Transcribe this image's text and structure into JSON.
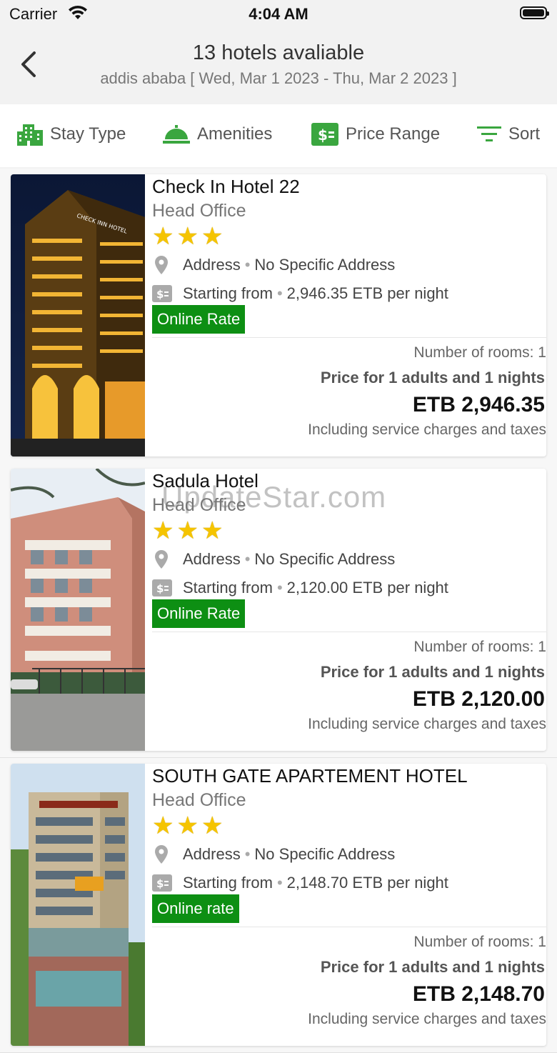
{
  "status_bar": {
    "carrier": "Carrier",
    "time": "4:04 AM"
  },
  "header": {
    "title": "13 hotels avaliable",
    "subtitle": "addis ababa [ Wed, Mar 1 2023 - Thu, Mar 2 2023 ]"
  },
  "filters": [
    {
      "label": "Stay Type",
      "icon": "building-icon"
    },
    {
      "label": "Amenities",
      "icon": "service-bell-icon"
    },
    {
      "label": "Price Range",
      "icon": "money-icon"
    },
    {
      "label": "Sort",
      "icon": "sort-icon"
    }
  ],
  "hotels": [
    {
      "name": "Check In Hotel 22",
      "branch": "Head Office",
      "stars": [
        "★",
        "★",
        "★"
      ],
      "address_label": "Address",
      "address_value": "No Specific Address",
      "starting_label": "Starting from",
      "starting_value": "2,946.35 ETB per night",
      "rate_label": "Online Rate",
      "rooms": "Number of rooms: 1",
      "price_for": "Price for 1 adults and 1 nights",
      "price": "ETB 2,946.35",
      "taxes": "Including service charges and taxes"
    },
    {
      "name": "Sadula Hotel",
      "branch": "Head Office",
      "stars": [
        "★",
        "★",
        "★"
      ],
      "address_label": "Address",
      "address_value": "No Specific Address",
      "starting_label": "Starting from",
      "starting_value": "2,120.00 ETB per night",
      "rate_label": "Online Rate",
      "rooms": "Number of rooms: 1",
      "price_for": "Price for 1 adults and 1 nights",
      "price": "ETB 2,120.00",
      "taxes": "Including service charges and taxes"
    },
    {
      "name": "SOUTH GATE APARTEMENT HOTEL",
      "branch": "Head Office",
      "stars": [
        "★",
        "★",
        "★"
      ],
      "address_label": "Address",
      "address_value": "No Specific Address",
      "starting_label": "Starting from",
      "starting_value": "2,148.70 ETB per night",
      "rate_label": "Online rate",
      "rooms": "Number of rooms: 1",
      "price_for": "Price for 1 adults and 1 nights",
      "price": "ETB 2,148.70",
      "taxes": "Including service charges and taxes"
    }
  ],
  "watermark": "UpdateStar.com",
  "colors": {
    "accent_green": "#0d8f13",
    "icon_green": "#3aa63f",
    "star": "#f5c400"
  }
}
